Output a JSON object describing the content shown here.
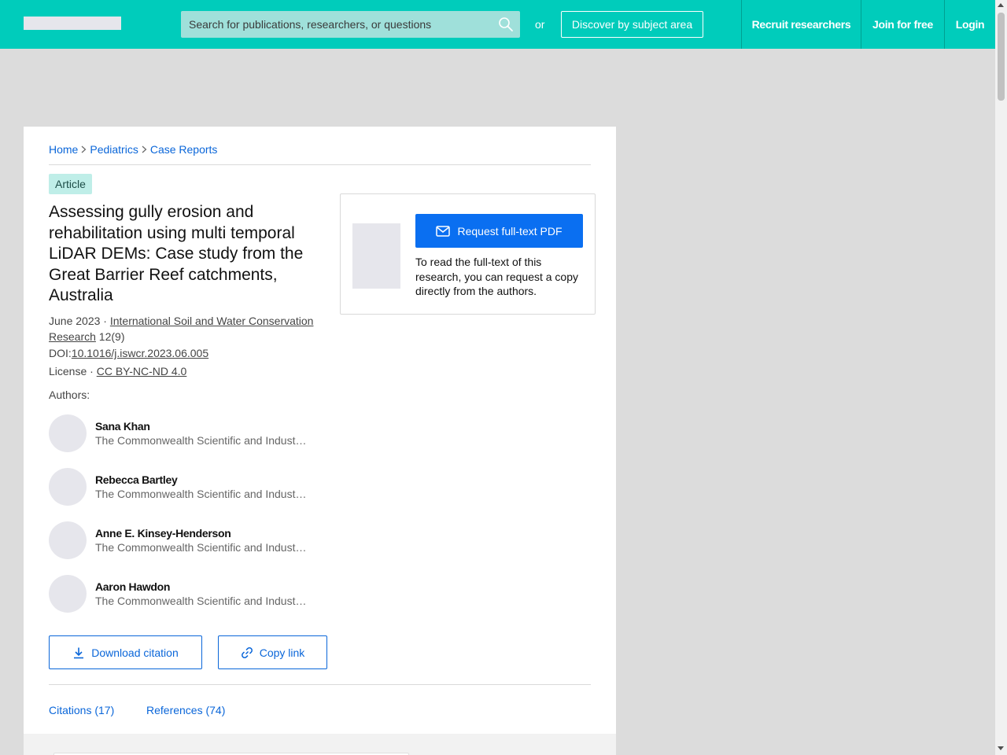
{
  "header": {
    "search_placeholder": "Search for publications, researchers, or questions",
    "or_text": "or",
    "discover_label": "Discover by subject area",
    "nav": {
      "recruit": "Recruit researchers",
      "join": "Join for free",
      "login": "Login"
    }
  },
  "breadcrumb": [
    "Home",
    "Pediatrics",
    "Case Reports"
  ],
  "article": {
    "badge": "Article",
    "title": "Assessing gully erosion and rehabilitation using multi temporal LiDAR DEMs: Case study from the Great Barrier Reef catchments, Australia",
    "date": "June 2023 · ",
    "journal": "International Soil and Water Conservation Research",
    "volume_issue": " 12(9)",
    "doi_label": "DOI:",
    "doi": "10.1016/j.iswcr.2023.06.005",
    "license_label": "License · ",
    "license": "CC BY-NC-ND 4.0",
    "authors_label": "Authors:",
    "authors": [
      {
        "name": "Sana Khan",
        "affiliation": "The Commonwealth Scientific and Industrial Research Organisation"
      },
      {
        "name": "Rebecca Bartley",
        "affiliation": "The Commonwealth Scientific and Industrial Research Organisation"
      },
      {
        "name": "Anne E. Kinsey-Henderson",
        "affiliation": "The Commonwealth Scientific and Industrial Research Organisation"
      },
      {
        "name": "Aaron Hawdon",
        "affiliation": "The Commonwealth Scientific and Industrial Research Organisation"
      }
    ]
  },
  "actions": {
    "download_citation": "Download citation",
    "copy_link": "Copy link"
  },
  "request": {
    "button_label": "Request full-text PDF",
    "text": "To read the full-text of this research, you can request a copy directly from the authors."
  },
  "tabs": {
    "citations": "Citations (17)",
    "references": "References (74)"
  },
  "colors": {
    "header_bg": "#00ccbb",
    "link_blue": "#0a66d9",
    "primary_button": "#0a6ff1",
    "badge_bg": "#bfeee8"
  }
}
